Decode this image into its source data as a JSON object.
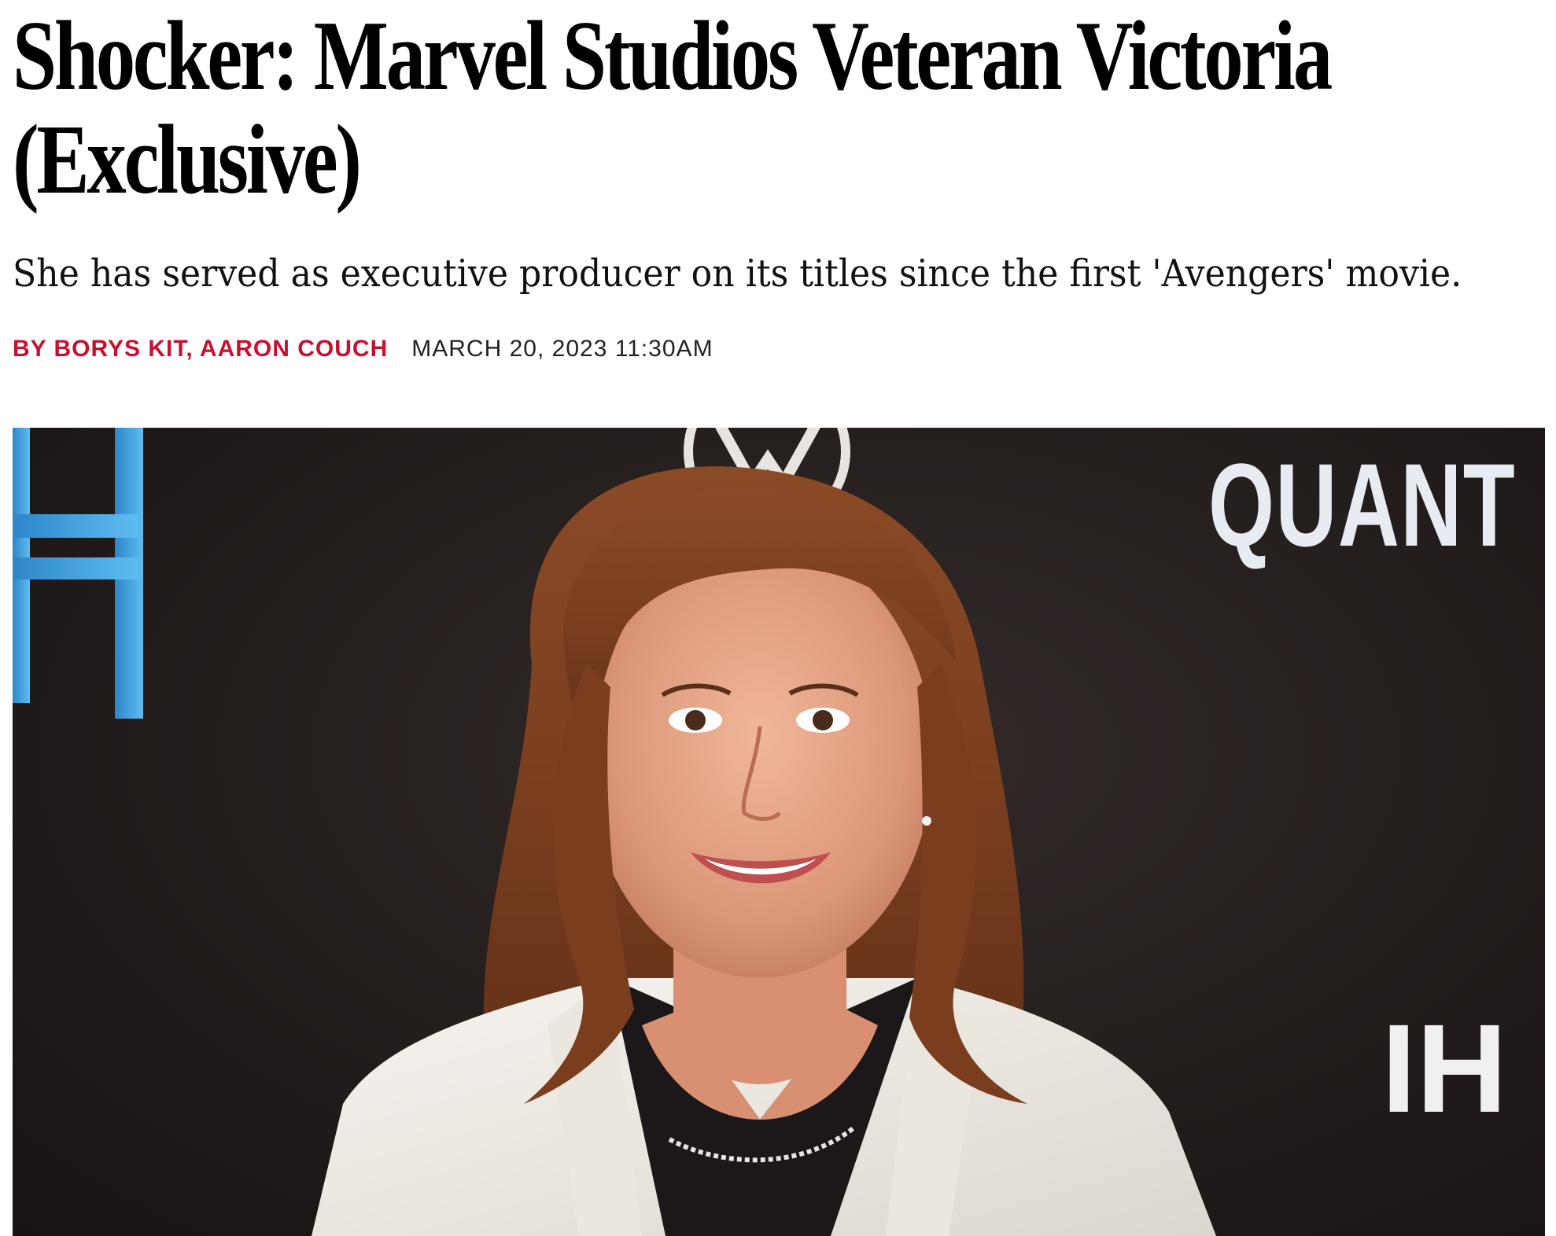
{
  "article": {
    "headline_line1": "Shocker: Marvel Studios Veteran Victoria",
    "headline_line2": "(Exclusive)",
    "dek": "She has served as executive producer on its titles since the first 'Avengers' movie.",
    "byline": "BY BORYS KIT, AARON COUCH",
    "dateline": "MARCH 20, 2023 11:30AM"
  },
  "photo": {
    "backdrop_text_top_right": "QUANT",
    "backdrop_text_bottom_right": "IH",
    "backdrop_letter_left": "H"
  },
  "colors": {
    "byline_red": "#c8102e",
    "backdrop_dark": "#231d1c",
    "backdrop_blue": "#3aa0e0"
  }
}
